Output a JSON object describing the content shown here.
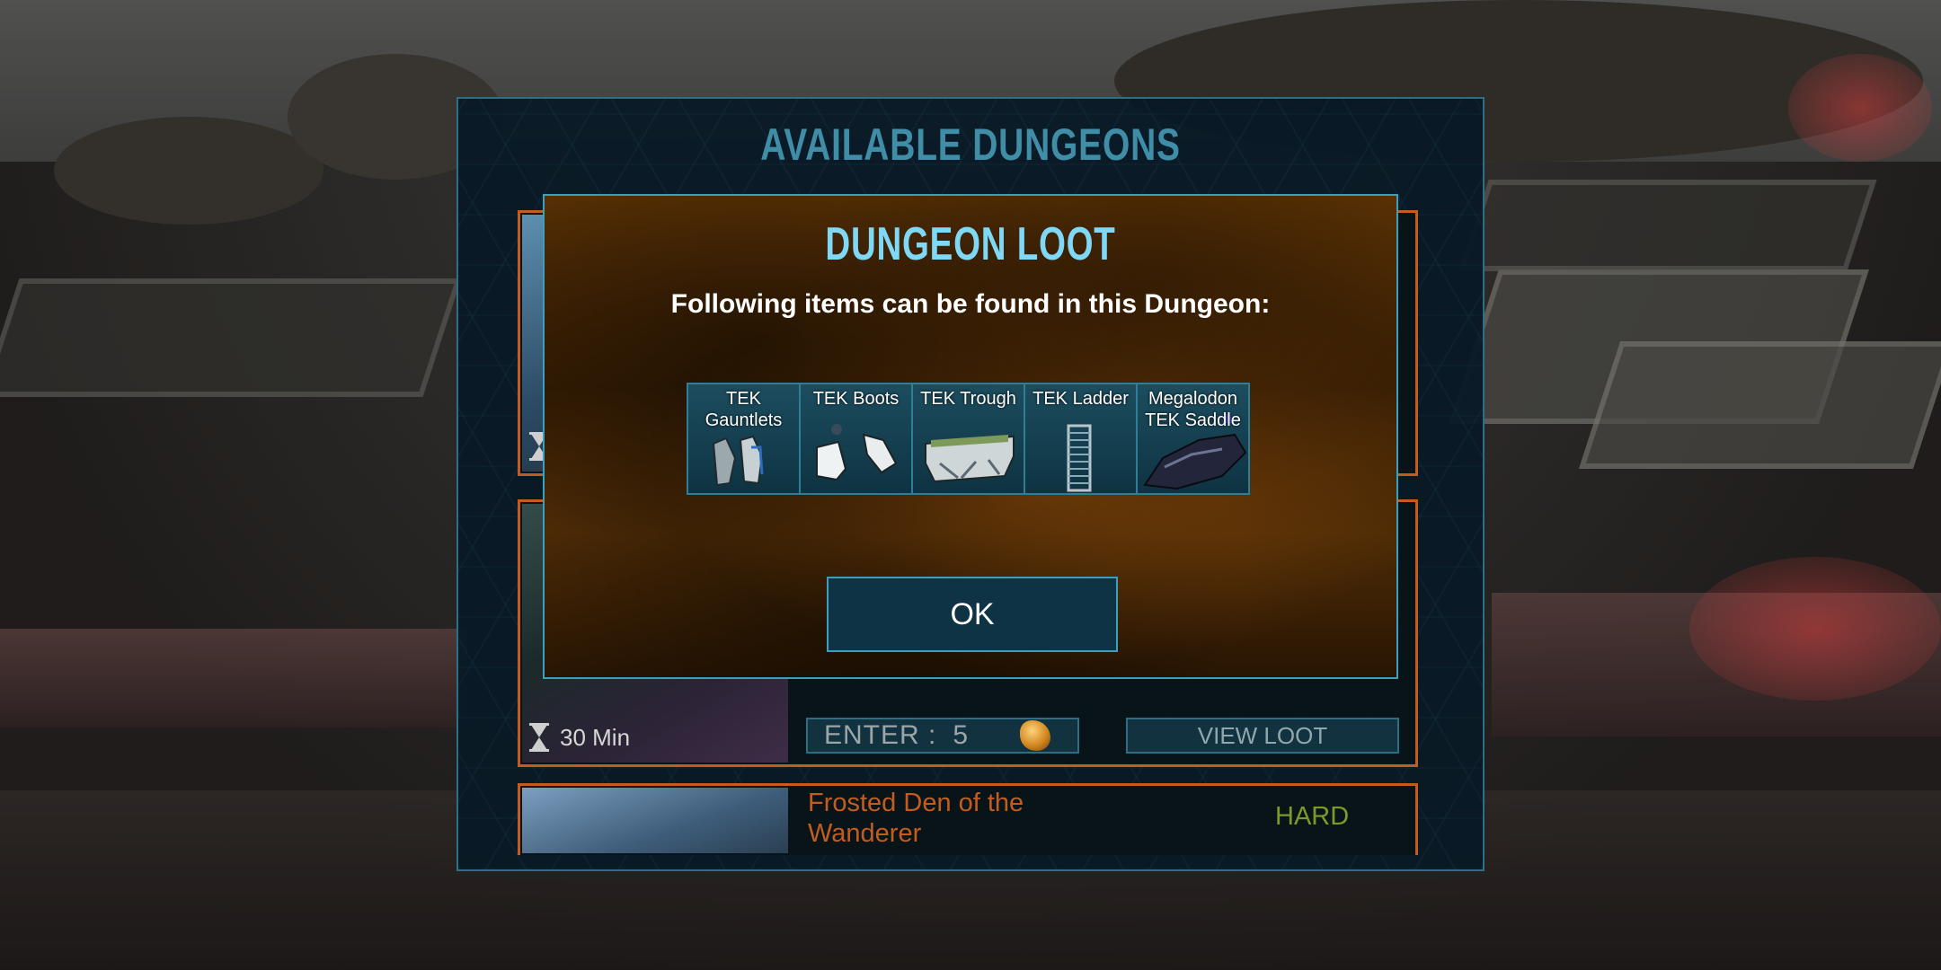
{
  "dungeons_panel": {
    "title": "AVAILABLE DUNGEONS",
    "cards": [
      {},
      {
        "duration": "30 Min",
        "enter_label": "ENTER :",
        "enter_cost": "5",
        "view_loot_label": "VIEW LOOT"
      },
      {
        "name_line1": "Frosted Den of the",
        "name_line2": "Wanderer",
        "difficulty": "HARD"
      }
    ]
  },
  "loot_modal": {
    "title": "DUNGEON LOOT",
    "subtitle": "Following items can be found in this Dungeon:",
    "items": [
      {
        "name": "TEK Gauntlets",
        "icon": "tek-gauntlets-icon"
      },
      {
        "name": "TEK Boots",
        "icon": "tek-boots-icon"
      },
      {
        "name": "TEK Trough",
        "icon": "tek-trough-icon"
      },
      {
        "name": "TEK Ladder",
        "icon": "tek-ladder-icon"
      },
      {
        "name": "Megalodon TEK Saddle",
        "icon": "megalodon-tek-saddle-icon"
      }
    ],
    "ok_label": "OK"
  },
  "colors": {
    "panel_border": "#2e6f86",
    "card_border": "#c55b1d",
    "modal_border": "#3b9fbf",
    "modal_title": "#7fd8f6",
    "difficulty_hard": "#7b9a2a"
  }
}
